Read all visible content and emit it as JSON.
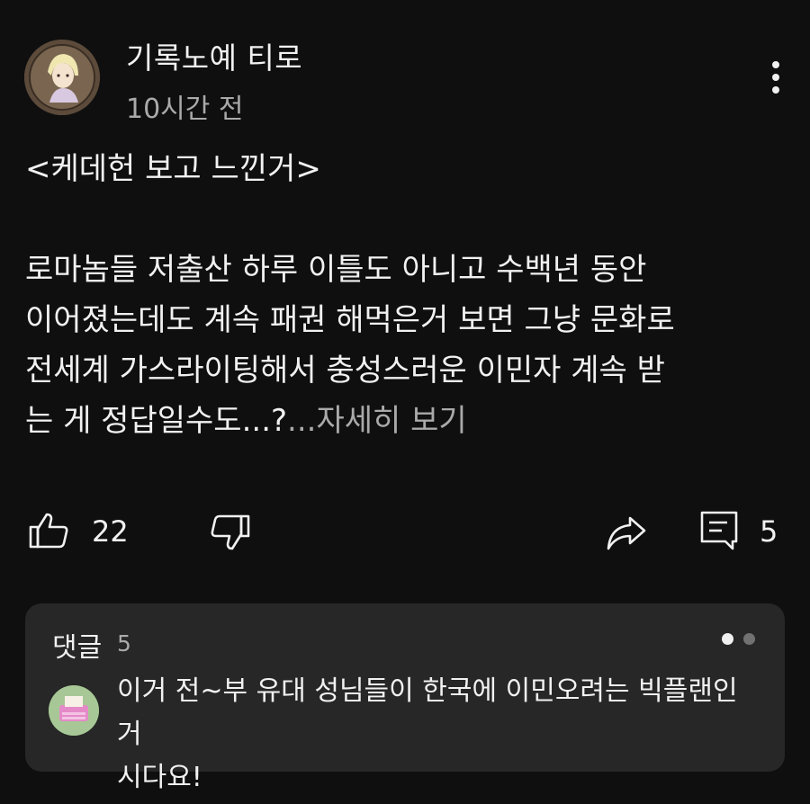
{
  "post": {
    "author": "기록노예 티로",
    "time": "10시간 전",
    "avatar_icon": "anime-character-avatar",
    "more_icon": "more-vertical-icon",
    "body": "<케데헌 보고 느낀거>\n\n로마놈들 저출산 하루 이틀도 아니고 수백년 동안\n이어졌는데도 계속 패권 해먹은거 보면 그냥 문화로\n전세계 가스라이팅해서 충성스러운 이민자 계속 받\n는 게 정답일수도...?",
    "read_more": "...자세히 보기"
  },
  "actions": {
    "like_count": "22",
    "comment_count": "5",
    "like_icon": "thumbs-up-icon",
    "dislike_icon": "thumbs-down-icon",
    "share_icon": "share-icon",
    "comment_icon": "comment-icon"
  },
  "comments": {
    "title": "댓글",
    "count": "5",
    "first_comment": "이거 전~부 유대 성님들이 한국에 이민오려는 빅플랜인 거\n시다요!",
    "commenter_avatar_icon": "pink-typewriter-avatar",
    "carousel_active_color": "#f1f1f1",
    "carousel_inactive_color": "#717171"
  },
  "colors": {
    "background": "#0f0f0f",
    "card": "#272727",
    "primary_text": "#f1f1f1",
    "secondary_text": "#aaaaaa"
  }
}
